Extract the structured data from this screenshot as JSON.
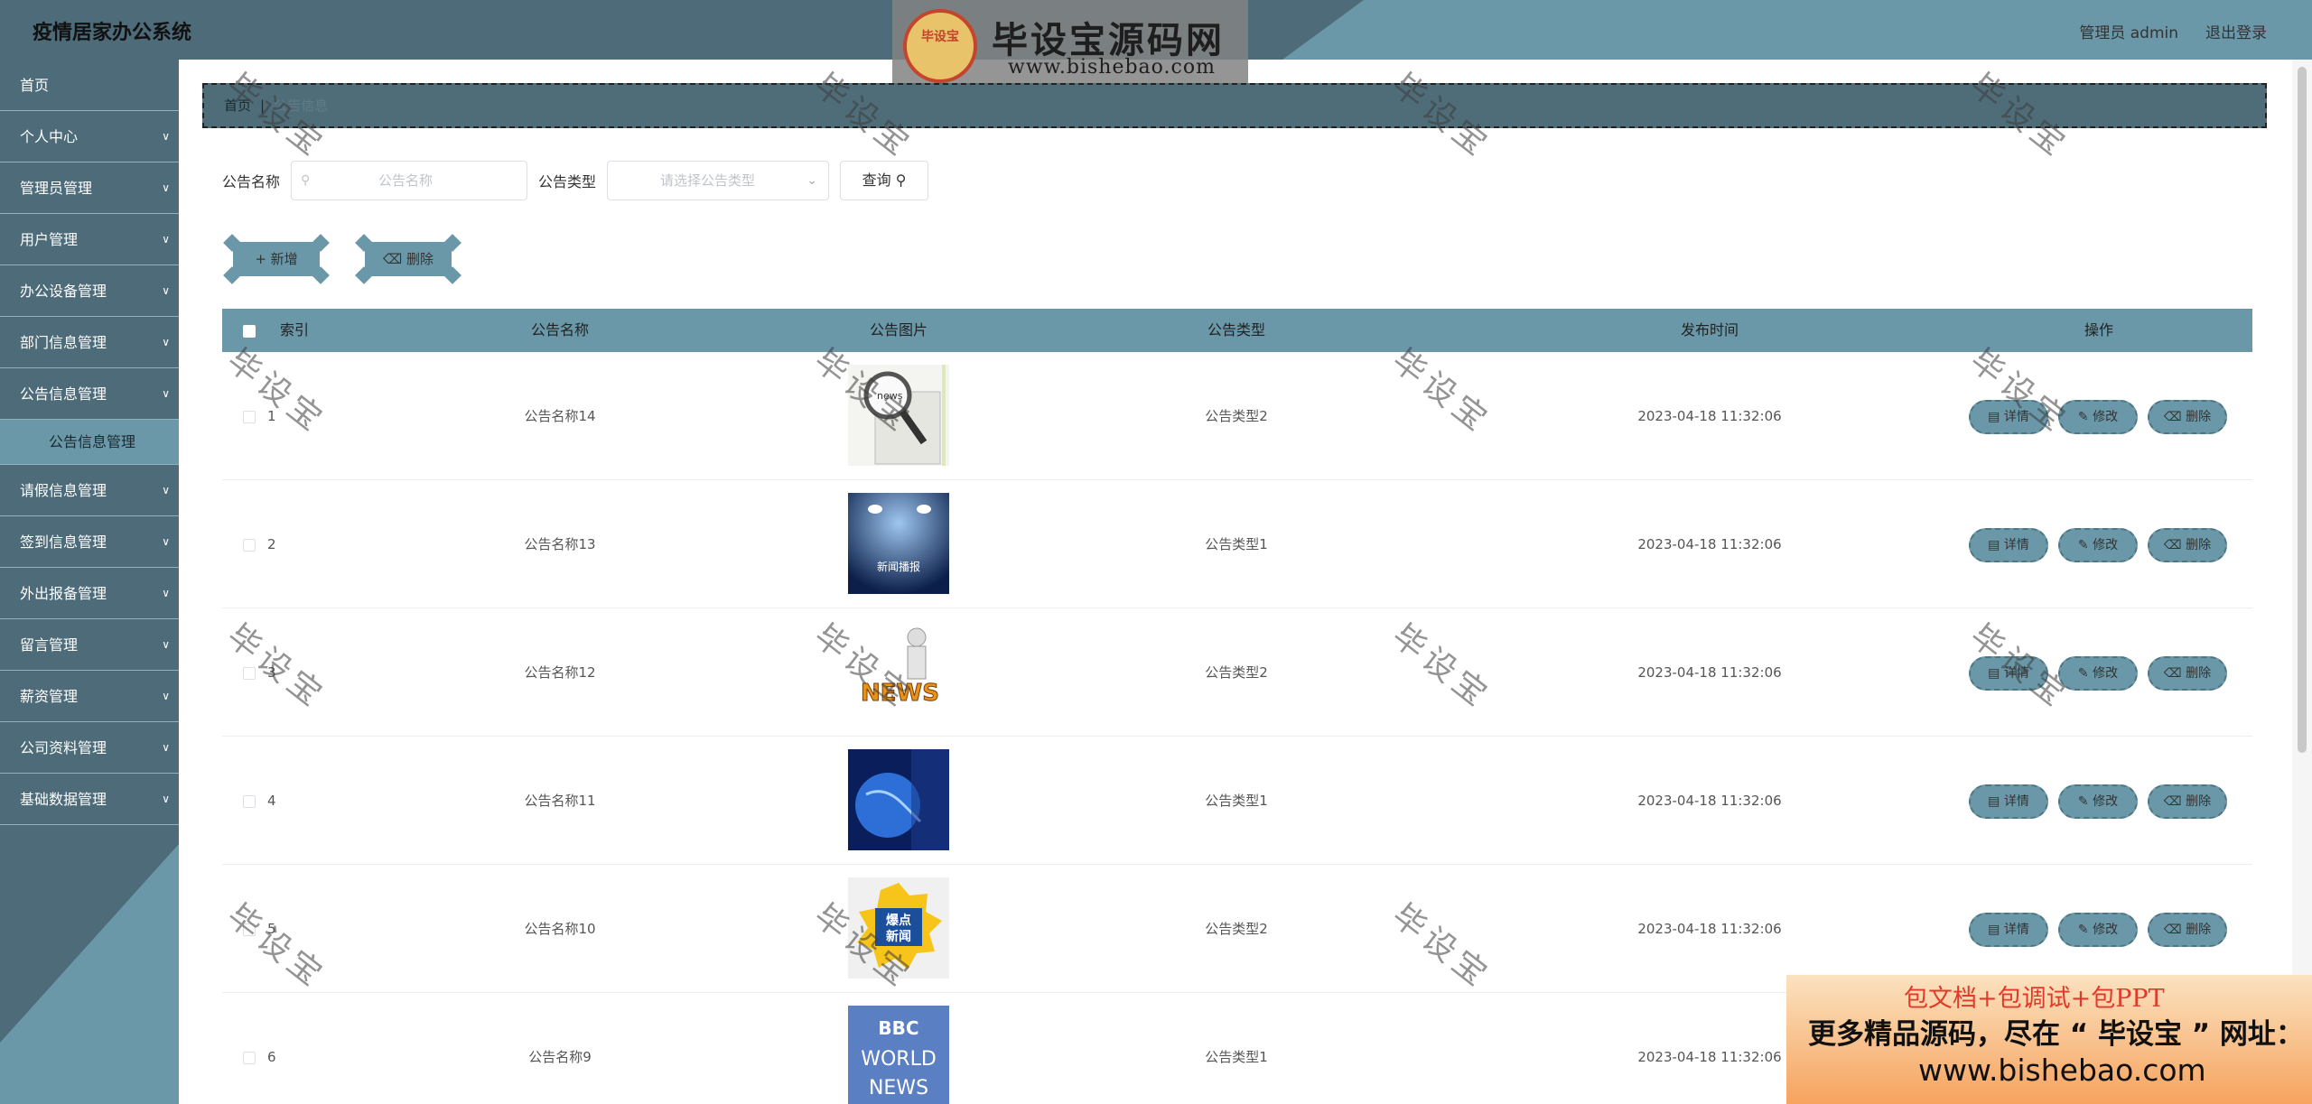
{
  "header": {
    "system_title": "疫情居家办公系统",
    "user_info": "管理员 admin",
    "logout_label": "退出登录"
  },
  "logo_banner": {
    "badge_text": "毕设宝",
    "brand": "毕设宝源码网",
    "url": "www.bishebao.com"
  },
  "sidebar": {
    "items": [
      {
        "label": "首页",
        "has_arrow": false
      },
      {
        "label": "个人中心",
        "has_arrow": true
      },
      {
        "label": "管理员管理",
        "has_arrow": true
      },
      {
        "label": "用户管理",
        "has_arrow": true
      },
      {
        "label": "办公设备管理",
        "has_arrow": true
      },
      {
        "label": "部门信息管理",
        "has_arrow": true
      },
      {
        "label": "公告信息管理",
        "has_arrow": true
      },
      {
        "label": "请假信息管理",
        "has_arrow": true
      },
      {
        "label": "签到信息管理",
        "has_arrow": true
      },
      {
        "label": "外出报备管理",
        "has_arrow": true
      },
      {
        "label": "留言管理",
        "has_arrow": true
      },
      {
        "label": "薪资管理",
        "has_arrow": true
      },
      {
        "label": "公司资料管理",
        "has_arrow": true
      },
      {
        "label": "基础数据管理",
        "has_arrow": true
      }
    ],
    "active_submenu": "公告信息管理"
  },
  "breadcrumb": {
    "home": "首页",
    "current": "公告信息"
  },
  "search": {
    "name_label": "公告名称",
    "name_placeholder": "公告名称",
    "type_label": "公告类型",
    "type_placeholder": "请选择公告类型",
    "query_label": "查询"
  },
  "actions": {
    "add_label": "新增",
    "delete_label": "删除"
  },
  "table": {
    "headers": {
      "index": "索引",
      "name": "公告名称",
      "image": "公告图片",
      "type": "公告类型",
      "time": "发布时间",
      "ops": "操作"
    },
    "row_buttons": {
      "detail": "详情",
      "edit": "修改",
      "delete": "删除"
    },
    "rows": [
      {
        "index": "1",
        "name": "公告名称14",
        "image": "news-magnifier-image",
        "type": "公告类型2",
        "time": "2023-04-18 11:32:06"
      },
      {
        "index": "2",
        "name": "公告名称13",
        "image": "stage-news-image",
        "type": "公告类型1",
        "time": "2023-04-18 11:32:06"
      },
      {
        "index": "3",
        "name": "公告名称12",
        "image": "news-figure-image",
        "type": "公告类型2",
        "time": "2023-04-18 11:32:06"
      },
      {
        "index": "4",
        "name": "公告名称11",
        "image": "globe-news-image",
        "type": "公告类型1",
        "time": "2023-04-18 11:32:06"
      },
      {
        "index": "5",
        "name": "公告名称10",
        "image": "breaking-news-image",
        "type": "公告类型2",
        "time": "2023-04-18 11:32:06"
      },
      {
        "index": "6",
        "name": "公告名称9",
        "image": "bbc-world-news-image",
        "type": "公告类型1",
        "time": "2023-04-18 11:32:06"
      }
    ]
  },
  "watermark_text": "毕设宝",
  "promo": {
    "line1": "包文档+包调试+包PPT",
    "line2": "更多精品源码，尽在 “ 毕设宝 ” 网址：",
    "line3": "www.bishebao.com"
  },
  "images": {
    "stage_caption": "新闻播报",
    "news_text": "NEWS",
    "breaking_text": "爆点新闻",
    "bbc_lines": [
      "BBC",
      "WORLD",
      "NEWS"
    ]
  }
}
